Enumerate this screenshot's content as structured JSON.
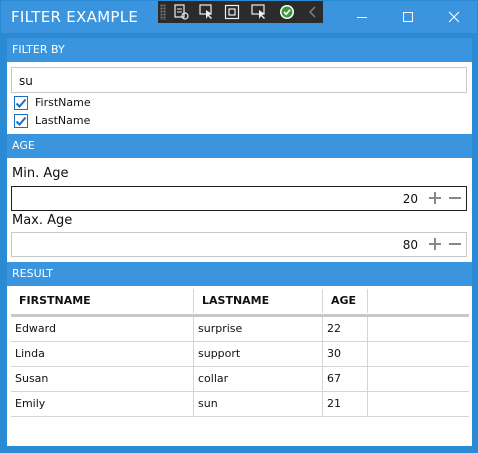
{
  "window": {
    "title": "FILTER EXAMPLE"
  },
  "filter": {
    "section_title": "FILTER BY",
    "search_value": "su",
    "checkboxes": [
      {
        "label": "FirstName",
        "checked": true
      },
      {
        "label": "LastName",
        "checked": true
      }
    ]
  },
  "age": {
    "section_title": "AGE",
    "min_label": "Min. Age",
    "min_value": "20",
    "max_label": "Max. Age",
    "max_value": "80"
  },
  "result": {
    "section_title": "RESULT",
    "columns": [
      "FIRSTNAME",
      "LASTNAME",
      "AGE"
    ],
    "rows": [
      [
        "Edward",
        "surprise",
        "22"
      ],
      [
        "Linda",
        "support",
        "30"
      ],
      [
        "Susan",
        "collar",
        "67"
      ],
      [
        "Emily",
        "sun",
        "21"
      ]
    ]
  },
  "colors": {
    "accent": "#3a95de",
    "checkbox": "#1b6fc1"
  }
}
